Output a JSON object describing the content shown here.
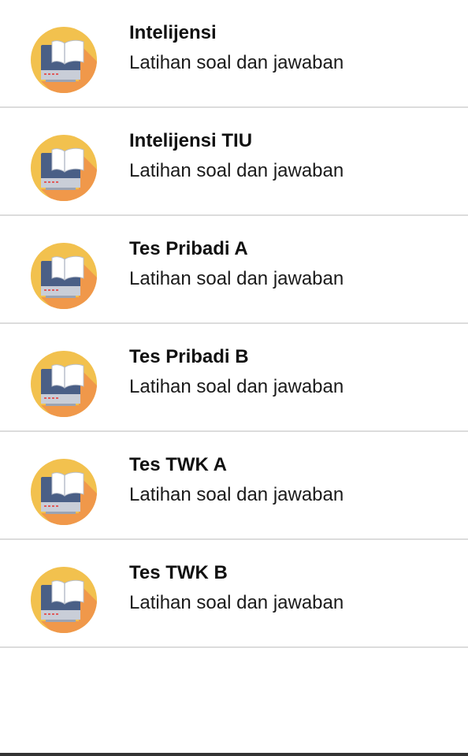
{
  "colors": {
    "icon_circle": "#F2C14E",
    "icon_shadow": "#F0984A",
    "monitor_body": "#4A5F86",
    "monitor_base": "#C9CED8",
    "book_page": "#FFFFFF",
    "divider": "#DCDCDC"
  },
  "items": [
    {
      "title": "Intelijensi",
      "subtitle": "Latihan soal dan jawaban",
      "icon": "computer-book-icon"
    },
    {
      "title": "Intelijensi TIU",
      "subtitle": "Latihan soal dan jawaban",
      "icon": "computer-book-icon"
    },
    {
      "title": "Tes Pribadi A",
      "subtitle": "Latihan soal dan jawaban",
      "icon": "computer-book-icon"
    },
    {
      "title": "Tes Pribadi B",
      "subtitle": "Latihan soal dan jawaban",
      "icon": "computer-book-icon"
    },
    {
      "title": "Tes TWK A",
      "subtitle": "Latihan soal dan jawaban",
      "icon": "computer-book-icon"
    },
    {
      "title": "Tes TWK B",
      "subtitle": "Latihan soal dan jawaban",
      "icon": "computer-book-icon"
    }
  ]
}
